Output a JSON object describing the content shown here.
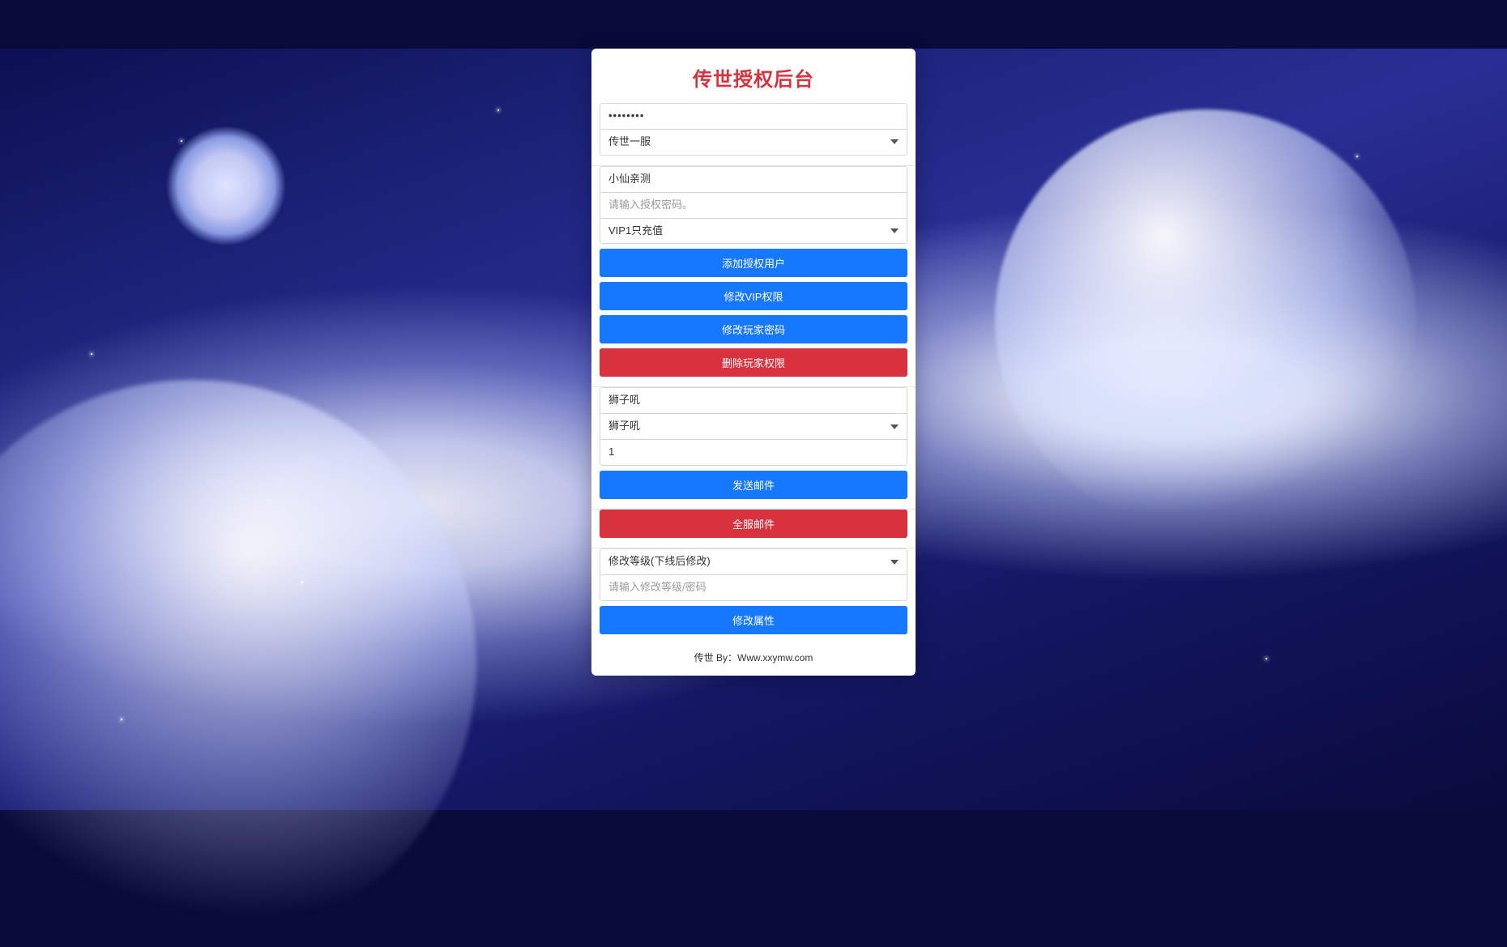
{
  "title": "传世授权后台",
  "group1": {
    "password_value": "••••••••",
    "server_select": "传世一服"
  },
  "group2": {
    "username_value": "小仙亲测",
    "authpw_placeholder": "请输入授权密码。",
    "vip_select": "VIP1只充值",
    "btn_add": "添加授权用户",
    "btn_vip": "修改VIP权限",
    "btn_pw": "修改玩家密码",
    "btn_del": "删除玩家权限"
  },
  "group3": {
    "item_input": "狮子吼",
    "item_select": "狮子吼",
    "qty_value": "1",
    "btn_send": "发送邮件"
  },
  "group4": {
    "btn_all": "全服邮件"
  },
  "group5": {
    "mode_select": "修改等级(下线后修改)",
    "mod_placeholder": "请输入修改等级/密码",
    "btn_mod": "修改属性"
  },
  "footer": "传世 By：Www.xxymw.com"
}
